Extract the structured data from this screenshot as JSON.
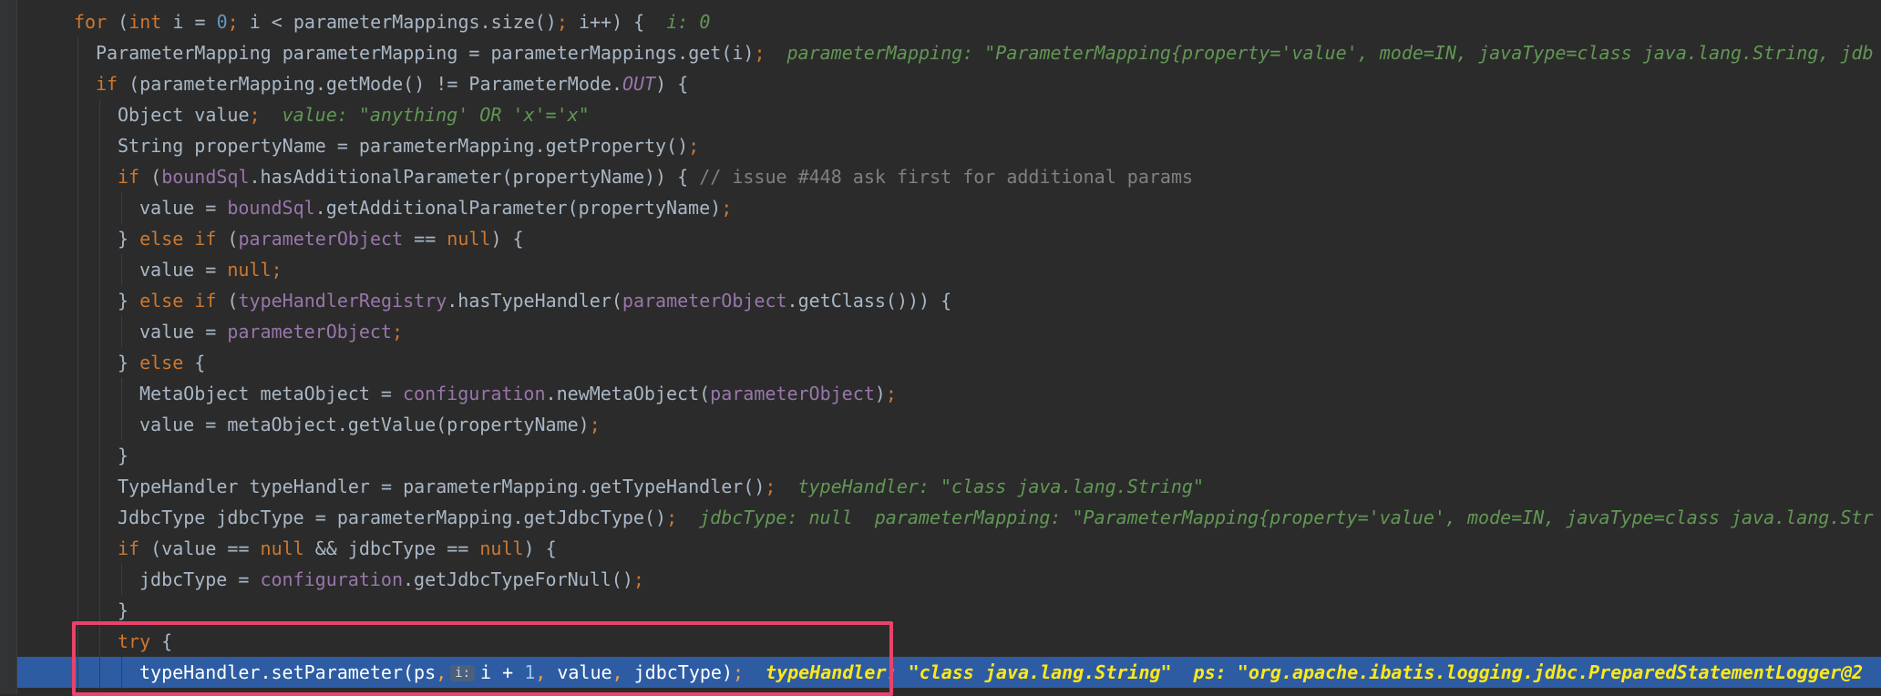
{
  "editor": {
    "lines": [
      {
        "parts": [
          [
            "k",
            "for"
          ],
          [
            "p",
            " ("
          ],
          [
            "k",
            "int"
          ],
          [
            "p",
            " i = "
          ],
          [
            "n",
            "0"
          ],
          [
            "k",
            ";"
          ],
          [
            "p",
            " i < parameterMappings.size()"
          ],
          [
            "k",
            ";"
          ],
          [
            "p",
            " i++) {"
          ]
        ],
        "hint": "i: 0"
      },
      {
        "parts": [
          [
            "p",
            "ParameterMapping parameterMapping = parameterMappings.get(i)"
          ],
          [
            "k",
            ";"
          ]
        ],
        "hint": "parameterMapping: \"ParameterMapping{property='value', mode=IN, javaType=class java.lang.String, jdb"
      },
      {
        "parts": [
          [
            "k",
            "if"
          ],
          [
            "p",
            " (parameterMapping.getMode() != ParameterMode."
          ],
          [
            "fi",
            "OUT"
          ],
          [
            "p",
            ") {"
          ]
        ]
      },
      {
        "parts": [
          [
            "p",
            "Object value"
          ],
          [
            "k",
            ";"
          ]
        ],
        "hint": "value: \"anything' OR 'x'='x\""
      },
      {
        "parts": [
          [
            "p",
            "String propertyName = parameterMapping.getProperty()"
          ],
          [
            "k",
            ";"
          ]
        ]
      },
      {
        "parts": [
          [
            "k",
            "if"
          ],
          [
            "p",
            " ("
          ],
          [
            "f",
            "boundSql"
          ],
          [
            "p",
            ".hasAdditionalParameter(propertyName)) { "
          ],
          [
            "c",
            "// issue #448 ask first for additional params"
          ]
        ]
      },
      {
        "parts": [
          [
            "p",
            "value = "
          ],
          [
            "f",
            "boundSql"
          ],
          [
            "p",
            ".getAdditionalParameter(propertyName)"
          ],
          [
            "k",
            ";"
          ]
        ]
      },
      {
        "parts": [
          [
            "p",
            "} "
          ],
          [
            "k",
            "else if"
          ],
          [
            "p",
            " ("
          ],
          [
            "f",
            "parameterObject"
          ],
          [
            "p",
            " == "
          ],
          [
            "k",
            "null"
          ],
          [
            "p",
            ") {"
          ]
        ]
      },
      {
        "parts": [
          [
            "p",
            "value = "
          ],
          [
            "k",
            "null;"
          ]
        ]
      },
      {
        "parts": [
          [
            "p",
            "} "
          ],
          [
            "k",
            "else if"
          ],
          [
            "p",
            " ("
          ],
          [
            "f",
            "typeHandlerRegistry"
          ],
          [
            "p",
            ".hasTypeHandler("
          ],
          [
            "f",
            "parameterObject"
          ],
          [
            "p",
            ".getClass())) {"
          ]
        ]
      },
      {
        "parts": [
          [
            "p",
            "value = "
          ],
          [
            "f",
            "parameterObject"
          ],
          [
            "k",
            ";"
          ]
        ]
      },
      {
        "parts": [
          [
            "p",
            "} "
          ],
          [
            "k",
            "else"
          ],
          [
            "p",
            " {"
          ]
        ]
      },
      {
        "parts": [
          [
            "p",
            "MetaObject metaObject = "
          ],
          [
            "f",
            "configuration"
          ],
          [
            "p",
            ".newMetaObject("
          ],
          [
            "f",
            "parameterObject"
          ],
          [
            "p",
            ")"
          ],
          [
            "k",
            ";"
          ]
        ]
      },
      {
        "parts": [
          [
            "p",
            "value = metaObject.getValue(propertyName)"
          ],
          [
            "k",
            ";"
          ]
        ]
      },
      {
        "parts": [
          [
            "p",
            "}"
          ]
        ]
      },
      {
        "parts": [
          [
            "p",
            "TypeHandler typeHandler = parameterMapping.getTypeHandler()"
          ],
          [
            "k",
            ";"
          ]
        ],
        "hint": "typeHandler: \"class java.lang.String\""
      },
      {
        "parts": [
          [
            "p",
            "JdbcType jdbcType = parameterMapping.getJdbcType()"
          ],
          [
            "k",
            ";"
          ]
        ],
        "hint": "jdbcType: null  parameterMapping: \"ParameterMapping{property='value', mode=IN, javaType=class java.lang.Str"
      },
      {
        "parts": [
          [
            "k",
            "if"
          ],
          [
            "p",
            " (value == "
          ],
          [
            "k",
            "null"
          ],
          [
            "p",
            " && jdbcType == "
          ],
          [
            "k",
            "null"
          ],
          [
            "p",
            ") {"
          ]
        ]
      },
      {
        "parts": [
          [
            "p",
            "jdbcType = "
          ],
          [
            "f",
            "configuration"
          ],
          [
            "p",
            ".getJdbcTypeForNull()"
          ],
          [
            "k",
            ";"
          ]
        ]
      },
      {
        "parts": [
          [
            "p",
            "}"
          ]
        ]
      },
      {
        "parts": [
          [
            "k",
            "try"
          ],
          [
            "p",
            " {"
          ]
        ]
      },
      {
        "parts": [
          [
            "p",
            "typeHandler.setParameter(ps"
          ],
          [
            "k",
            ","
          ],
          [
            "chip",
            "i:"
          ],
          [
            "p",
            "i + "
          ],
          [
            "n",
            "1"
          ],
          [
            "k",
            ","
          ],
          [
            "p",
            " value"
          ],
          [
            "k",
            ","
          ],
          [
            "p",
            " jdbcType)"
          ],
          [
            "k",
            ";"
          ]
        ],
        "hint": "typeHandler: \"class java.lang.String\"  ps: \"org.apache.ibatis.logging.jdbc.PreparedStatementLogger@2"
      }
    ]
  }
}
